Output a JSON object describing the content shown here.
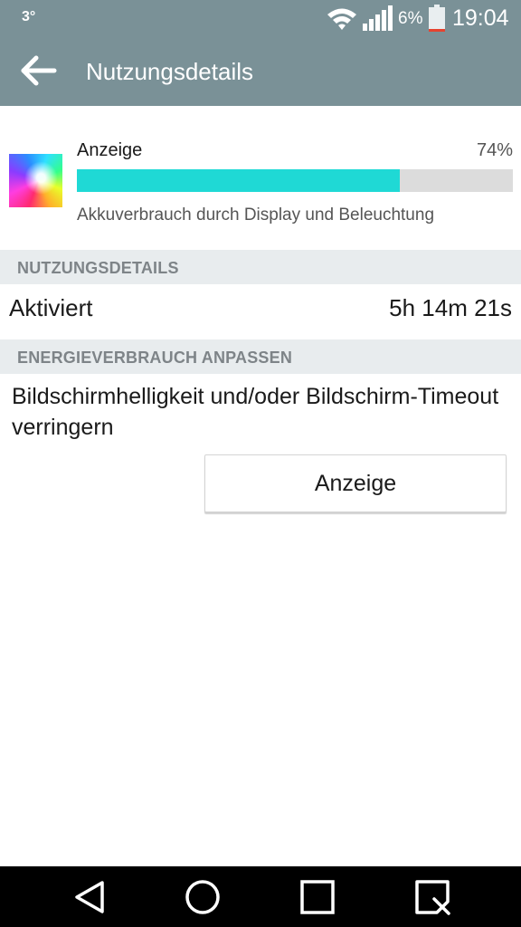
{
  "status_bar": {
    "temperature": "3°",
    "battery_percent": "6%",
    "time": "19:04",
    "battery_level_percent": 6,
    "icons": [
      "wifi-icon",
      "cell-signal-icon",
      "battery-icon"
    ]
  },
  "app_bar": {
    "title": "Nutzungsdetails",
    "back_icon": "arrow-left-icon"
  },
  "usage_item": {
    "name": "Anzeige",
    "percent_label": "74%",
    "percent_value": 74,
    "description": "Akkuverbrauch durch Display und Beleuchtung",
    "icon": "display-app-icon"
  },
  "sections": {
    "usage_details_header": "NUTZUNGSDETAILS",
    "adjust_header": "ENERGIEVERBRAUCH ANPASSEN"
  },
  "usage_row": {
    "label": "Aktiviert",
    "value": "5h 14m 21s"
  },
  "adjust": {
    "hint": "Bildschirmhelligkeit und/oder Bildschirm-Timeout verringern",
    "button_label": "Anzeige"
  },
  "nav_bar": {
    "icons": [
      "back-triangle-icon",
      "home-circle-icon",
      "recents-square-icon",
      "qslide-icon"
    ]
  },
  "colors": {
    "toolbar": "#7a9197",
    "progress_fill": "#1fd9d5",
    "progress_track": "#dcdcdc",
    "section_header_bg": "#e8ecee"
  }
}
